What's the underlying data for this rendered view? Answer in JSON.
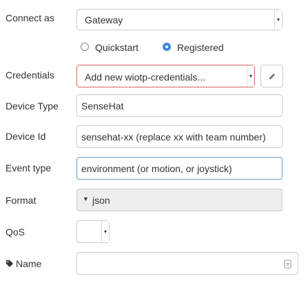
{
  "fields": {
    "connect_as": {
      "label": "Connect as",
      "value": "Gateway"
    },
    "mode": {
      "options": [
        "Quickstart",
        "Registered"
      ],
      "selected": "Registered"
    },
    "credentials": {
      "label": "Credentials",
      "value": "Add new wiotp-credentials..."
    },
    "device_type": {
      "label": "Device Type",
      "value": "SenseHat"
    },
    "device_id": {
      "label": "Device Id",
      "value": "sensehat-xx (replace xx with team number)"
    },
    "event_type": {
      "label": "Event type",
      "value": "environment (or motion, or joystick)"
    },
    "format": {
      "label": "Format",
      "value": "json"
    },
    "qos": {
      "label": "QoS",
      "value": ""
    },
    "name": {
      "label": "Name",
      "value": ""
    }
  },
  "icons": {
    "pencil": "pencil-icon",
    "tag": "tag-icon",
    "caret": "caret-down-icon",
    "doc": "document-icon"
  },
  "colors": {
    "error_border": "#d6615e",
    "focus_border": "#5b9bd5",
    "radio_selected": "#3b8ad9",
    "disabled_bg": "#eeeeee"
  }
}
